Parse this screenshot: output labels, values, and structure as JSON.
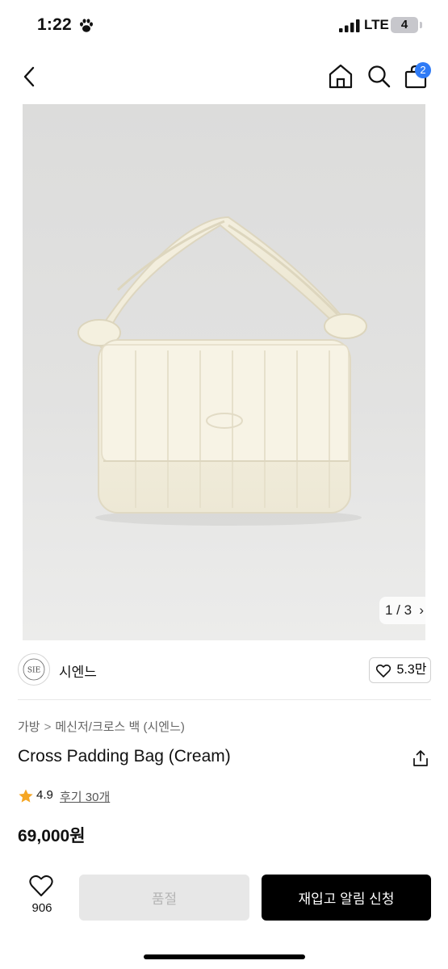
{
  "status_bar": {
    "time": "1:22",
    "network": "LTE",
    "battery": "4"
  },
  "nav": {
    "back_icon": "chevron-left-icon",
    "home_icon": "home-icon",
    "search_icon": "search-icon",
    "cart_icon": "shopping-bag-icon",
    "cart_count": "2"
  },
  "gallery": {
    "current": "1 / 3",
    "arrow": "›",
    "image": "cream quilted padded shoulder bag with knotted strap"
  },
  "seller": {
    "name": "시엔느",
    "logo_text": "SIE",
    "likes": "5.3만"
  },
  "product": {
    "breadcrumb": [
      "가방",
      "메신저/크로스 백 (시엔느)"
    ],
    "breadcrumb_sep": ">",
    "title": "Cross Padding Bag (Cream)",
    "rating": "4.9",
    "reviews": "후기 30개",
    "price": "69,000원"
  },
  "actions": {
    "favorite_count": "906",
    "soldout_label": "품절",
    "restock_label": "재입고 알림 신청"
  },
  "colors": {
    "accent_badge": "#2f7bf6",
    "star": "#f5a623",
    "primary_button": "#000000",
    "disabled_button": "#e7e7e7"
  }
}
